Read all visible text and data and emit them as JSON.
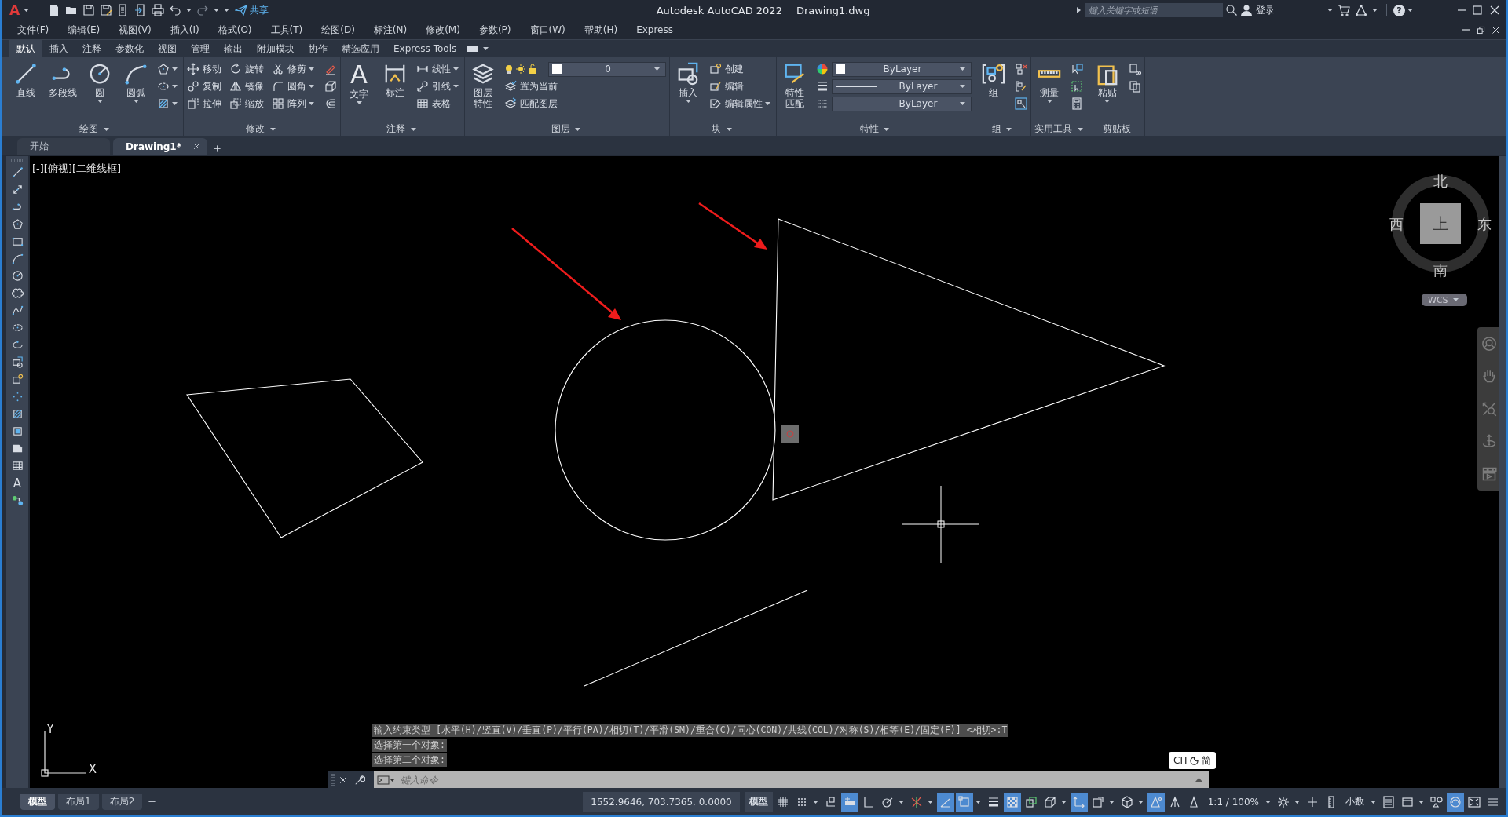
{
  "title_bar": {
    "logo": "A",
    "share": "共享",
    "app_title": "Autodesk AutoCAD 2022",
    "file_name": "Drawing1.dwg",
    "search_placeholder": "键入关键字或短语",
    "sign_in": "登录",
    "help": "?"
  },
  "menu_bar": [
    "文件(F)",
    "编辑(E)",
    "视图(V)",
    "插入(I)",
    "格式(O)",
    "工具(T)",
    "绘图(D)",
    "标注(N)",
    "修改(M)",
    "参数(P)",
    "窗口(W)",
    "帮助(H)",
    "Express"
  ],
  "ribbon_tabs": [
    {
      "label": "默认",
      "selected": true
    },
    {
      "label": "插入",
      "selected": false
    },
    {
      "label": "注释",
      "selected": false
    },
    {
      "label": "参数化",
      "selected": false
    },
    {
      "label": "视图",
      "selected": false
    },
    {
      "label": "管理",
      "selected": false
    },
    {
      "label": "输出",
      "selected": false
    },
    {
      "label": "附加模块",
      "selected": false
    },
    {
      "label": "协作",
      "selected": false
    },
    {
      "label": "精选应用",
      "selected": false
    },
    {
      "label": "Express Tools",
      "selected": false
    }
  ],
  "ribbon_panels": [
    {
      "title": "绘图",
      "tools": [
        {
          "kind": "large",
          "label": "直线"
        },
        {
          "kind": "large",
          "label": "多段线"
        },
        {
          "kind": "large",
          "label": "圆"
        },
        {
          "kind": "large",
          "label": "圆弧"
        },
        {
          "kind": "small"
        },
        {
          "kind": "small"
        },
        {
          "kind": "small"
        }
      ]
    },
    {
      "title": "修改",
      "tools": [
        {
          "kind": "small",
          "label": "移动"
        },
        {
          "kind": "small",
          "label": "复制"
        },
        {
          "kind": "small",
          "label": "拉伸"
        },
        {
          "kind": "small",
          "label": "旋转"
        },
        {
          "kind": "small",
          "label": "镜像"
        },
        {
          "kind": "small",
          "label": "缩放"
        },
        {
          "kind": "small",
          "label": "修剪"
        },
        {
          "kind": "small",
          "label": "圆角"
        },
        {
          "kind": "small",
          "label": "阵列"
        },
        {
          "kind": "small"
        },
        {
          "kind": "small"
        },
        {
          "kind": "small"
        }
      ]
    },
    {
      "title": "注释",
      "tools": [
        {
          "kind": "large",
          "glyph": "A",
          "label": "文字"
        },
        {
          "kind": "large",
          "label": "标注"
        },
        {
          "kind": "small",
          "label": "线性"
        },
        {
          "kind": "small",
          "label": "引线"
        },
        {
          "kind": "small",
          "label": "表格"
        }
      ]
    },
    {
      "title": "图层",
      "tools": [
        {
          "kind": "large",
          "label": "图层特性"
        },
        {
          "kind": "combo",
          "value": "0"
        },
        {
          "kind": "small",
          "label": "置为当前"
        },
        {
          "kind": "small",
          "label": "匹配图层"
        }
      ]
    },
    {
      "title": "块",
      "tools": [
        {
          "kind": "large",
          "label": "插入"
        },
        {
          "kind": "small",
          "label": "创建"
        },
        {
          "kind": "small",
          "label": "编辑"
        },
        {
          "kind": "small",
          "label": "编辑属性"
        }
      ]
    },
    {
      "title": "特性",
      "tools": [
        {
          "kind": "large",
          "label": "特性匹配"
        },
        {
          "kind": "combo",
          "value": "ByLayer"
        },
        {
          "kind": "combo",
          "value": "ByLayer"
        },
        {
          "kind": "combo",
          "value": "ByLayer"
        }
      ]
    },
    {
      "title": "组",
      "tools": [
        {
          "kind": "large",
          "label": "组"
        },
        {
          "kind": "small"
        },
        {
          "kind": "small"
        },
        {
          "kind": "small"
        }
      ]
    },
    {
      "title": "实用工具",
      "tools": [
        {
          "kind": "large",
          "label": "测量"
        },
        {
          "kind": "small"
        },
        {
          "kind": "small"
        },
        {
          "kind": "small"
        }
      ]
    },
    {
      "title": "剪贴板",
      "tools": [
        {
          "kind": "large",
          "label": "粘贴"
        },
        {
          "kind": "small"
        },
        {
          "kind": "small"
        }
      ]
    }
  ],
  "doc_tabs": [
    {
      "label": "开始",
      "selected": false,
      "closable": false
    },
    {
      "label": "Drawing1*",
      "selected": true,
      "closable": true
    }
  ],
  "viewport": {
    "label": "[-][俯视][二维线框]"
  },
  "left_toolbar": {
    "text_glyph": "A"
  },
  "viewcube": {
    "north": "北",
    "south": "南",
    "east": "东",
    "west": "西",
    "top": "上",
    "wcs": "WCS"
  },
  "ucs": {
    "x": "X",
    "y": "Y"
  },
  "command_history": [
    "输入约束类型 [水平(H)/竖直(V)/垂直(P)/平行(PA)/相切(T)/平滑(SM)/重合(C)/同心(CON)/共线(COL)/对称(S)/相等(E)/固定(F)] <相切>:T",
    "选择第一个对象:",
    "选择第二个对象:"
  ],
  "command_line": {
    "placeholder": "键入命令"
  },
  "ime": {
    "language": "CH",
    "mode": "简"
  },
  "status_bar": {
    "layout_tabs": [
      {
        "label": "模型",
        "selected": true
      },
      {
        "label": "布局1",
        "selected": false
      },
      {
        "label": "布局2",
        "selected": false
      }
    ],
    "coordinates": "1552.9646, 703.7365, 0.0000",
    "space": "模型",
    "items": [
      {
        "kind": "grid",
        "on": false
      },
      {
        "kind": "snap",
        "on": false
      },
      {
        "kind": "infer",
        "on": false
      },
      {
        "kind": "dyninput",
        "on": true
      },
      {
        "kind": "ortho",
        "on": false
      },
      {
        "kind": "polar",
        "on": false
      },
      {
        "kind": "isodraft",
        "on": false
      },
      {
        "kind": "osnaptrack",
        "on": true
      },
      {
        "kind": "osnap",
        "on": true
      },
      {
        "kind": "lineweight",
        "on": false
      },
      {
        "kind": "transparency",
        "on": true
      },
      {
        "kind": "selcycle",
        "on": false
      },
      {
        "kind": "cube",
        "on": false
      },
      {
        "kind": "dynucs",
        "on": true
      },
      {
        "kind": "selfilter",
        "on": false
      },
      {
        "kind": "gizmo",
        "on": false
      },
      {
        "kind": "annovis",
        "on": true
      },
      {
        "kind": "autoscale",
        "on": false
      },
      {
        "kind": "annoscale",
        "on": false
      },
      {
        "kind": "label",
        "label": "1:1 / 100%",
        "on": false
      },
      {
        "kind": "gear",
        "on": false
      },
      {
        "kind": "plus",
        "on": false
      },
      {
        "kind": "units",
        "on": false
      },
      {
        "kind": "label",
        "label": "小数",
        "on": false
      },
      {
        "kind": "quickprops",
        "on": false
      },
      {
        "kind": "lockui",
        "on": false
      },
      {
        "kind": "isolate",
        "on": false
      },
      {
        "kind": "hwaccel",
        "on": true
      },
      {
        "kind": "cleanscreen",
        "on": false
      },
      {
        "kind": "menu",
        "on": false
      }
    ]
  }
}
